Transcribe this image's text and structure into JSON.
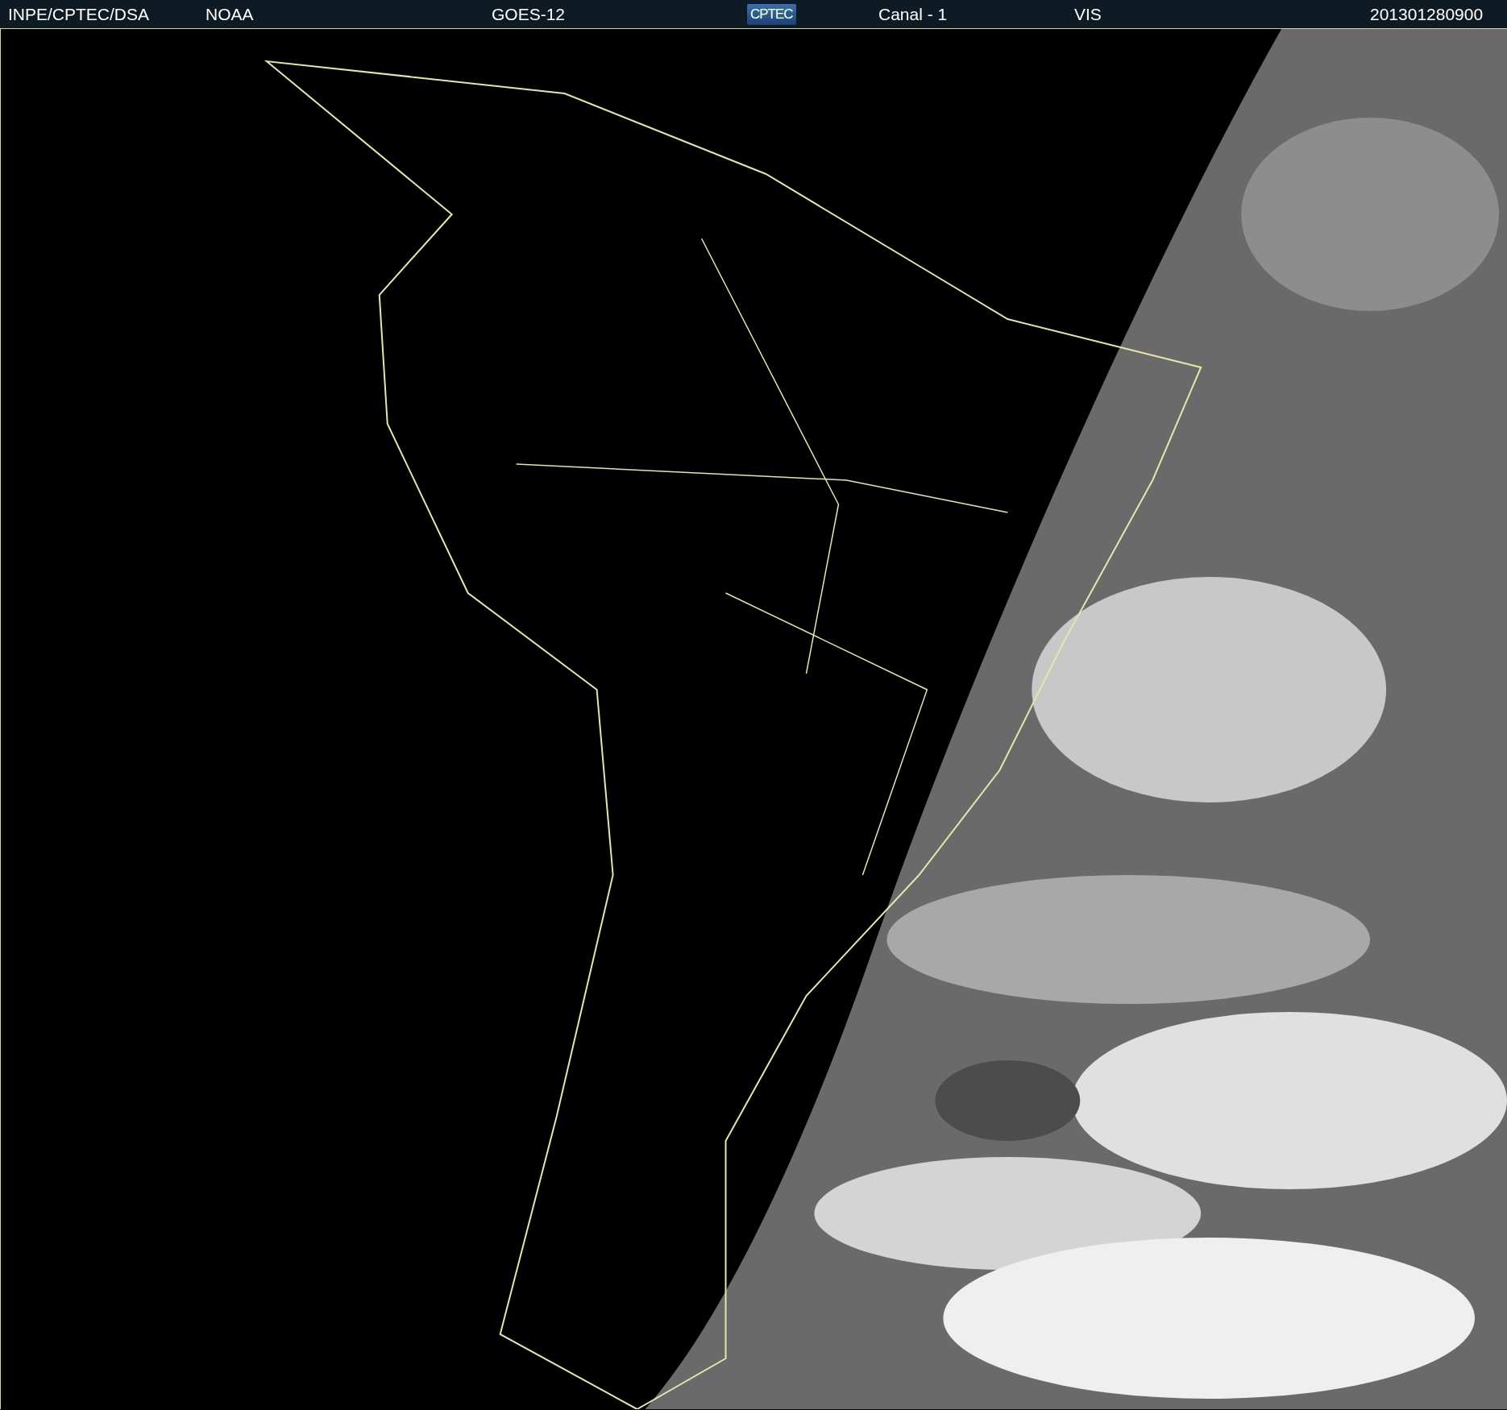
{
  "header": {
    "items": [
      {
        "kind": "text",
        "text": "INPE/CPTEC/DSA"
      },
      {
        "kind": "text",
        "text": "NOAA"
      },
      {
        "kind": "text",
        "text": "GOES-12"
      },
      {
        "kind": "logo",
        "text": "CPTEC"
      },
      {
        "kind": "text",
        "text": "Canal - 1"
      },
      {
        "kind": "text",
        "text": "VIS"
      },
      {
        "kind": "text",
        "text": "201301280900"
      }
    ]
  }
}
